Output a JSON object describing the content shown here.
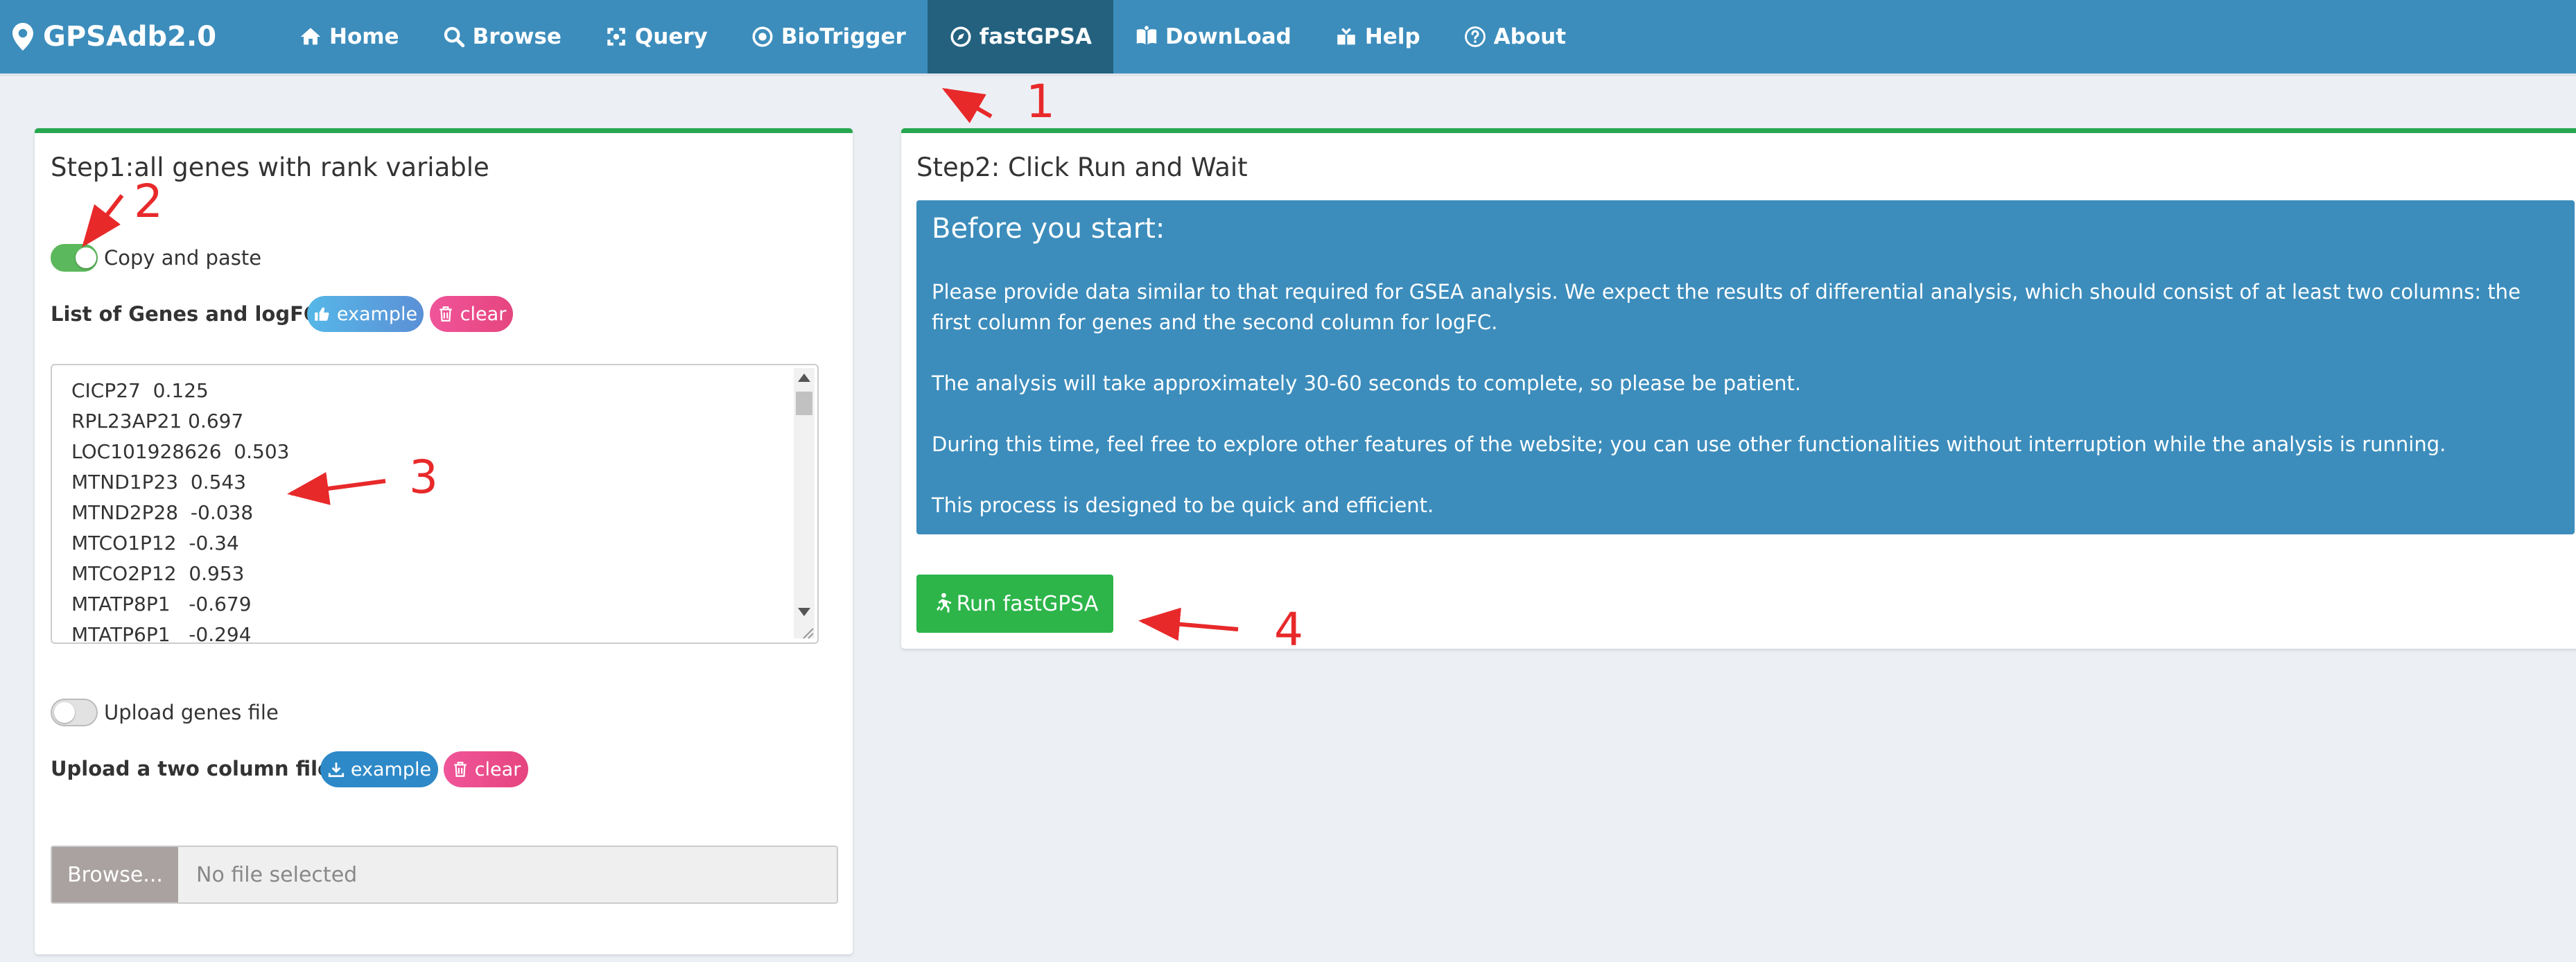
{
  "navbar": {
    "brand": "GPSAdb2.0",
    "items": [
      {
        "label": "Home",
        "icon": "home-icon"
      },
      {
        "label": "Browse",
        "icon": "search-icon"
      },
      {
        "label": "Query",
        "icon": "crosshair-icon"
      },
      {
        "label": "BioTrigger",
        "icon": "dot-circle-icon"
      },
      {
        "label": "fastGPSA",
        "icon": "compass-icon",
        "active": true
      },
      {
        "label": "DownLoad",
        "icon": "book-icon"
      },
      {
        "label": "Help",
        "icon": "hands-icon"
      },
      {
        "label": "About",
        "icon": "question-circle-icon"
      }
    ]
  },
  "step1": {
    "title": "Step1:all genes with rank variable",
    "copy_toggle_label": "Copy and paste",
    "copy_toggle_on": true,
    "genes_label": "List of Genes and logFC:",
    "example_label": "example",
    "clear_label": "clear",
    "genes_text": [
      "CICP27  0.125",
      "RPL23AP21 0.697",
      "LOC101928626  0.503",
      "MTND1P23  0.543",
      "MTND2P28  -0.038",
      "MTCO1P12  -0.34",
      "MTCO2P12  0.953",
      "MTATP8P1   -0.679",
      "MTATP6P1   -0.294"
    ],
    "upload_toggle_label": "Upload genes file",
    "upload_toggle_on": false,
    "upload_label": "Upload a two column file:",
    "upload_example_label": "example",
    "upload_clear_label": "clear",
    "browse_label": "Browse...",
    "file_placeholder": "No file selected"
  },
  "step2": {
    "title": "Step2: Click Run and Wait",
    "info_title": "Before you start:",
    "paragraphs": [
      "Please provide data similar to that required for GSEA analysis. We expect the results of differential analysis, which should consist of at least two columns: the first column for genes and the second column for logFC.",
      "The analysis will take approximately 30-60 seconds to complete, so please be patient.",
      "During this time, feel free to explore other features of the website; you can use other functionalities without interruption while the analysis is running.",
      "This process is designed to be quick and efficient."
    ],
    "run_label": "Run fastGPSA"
  },
  "annotations": [
    "1",
    "2",
    "3",
    "4"
  ],
  "colors": {
    "navbar": "#3c8dbc",
    "nav_active": "#23617f",
    "box_border": "#27a74f",
    "info_panel": "#3c8dbc",
    "run_button": "#2db54a",
    "annotation": "#e8292a"
  }
}
